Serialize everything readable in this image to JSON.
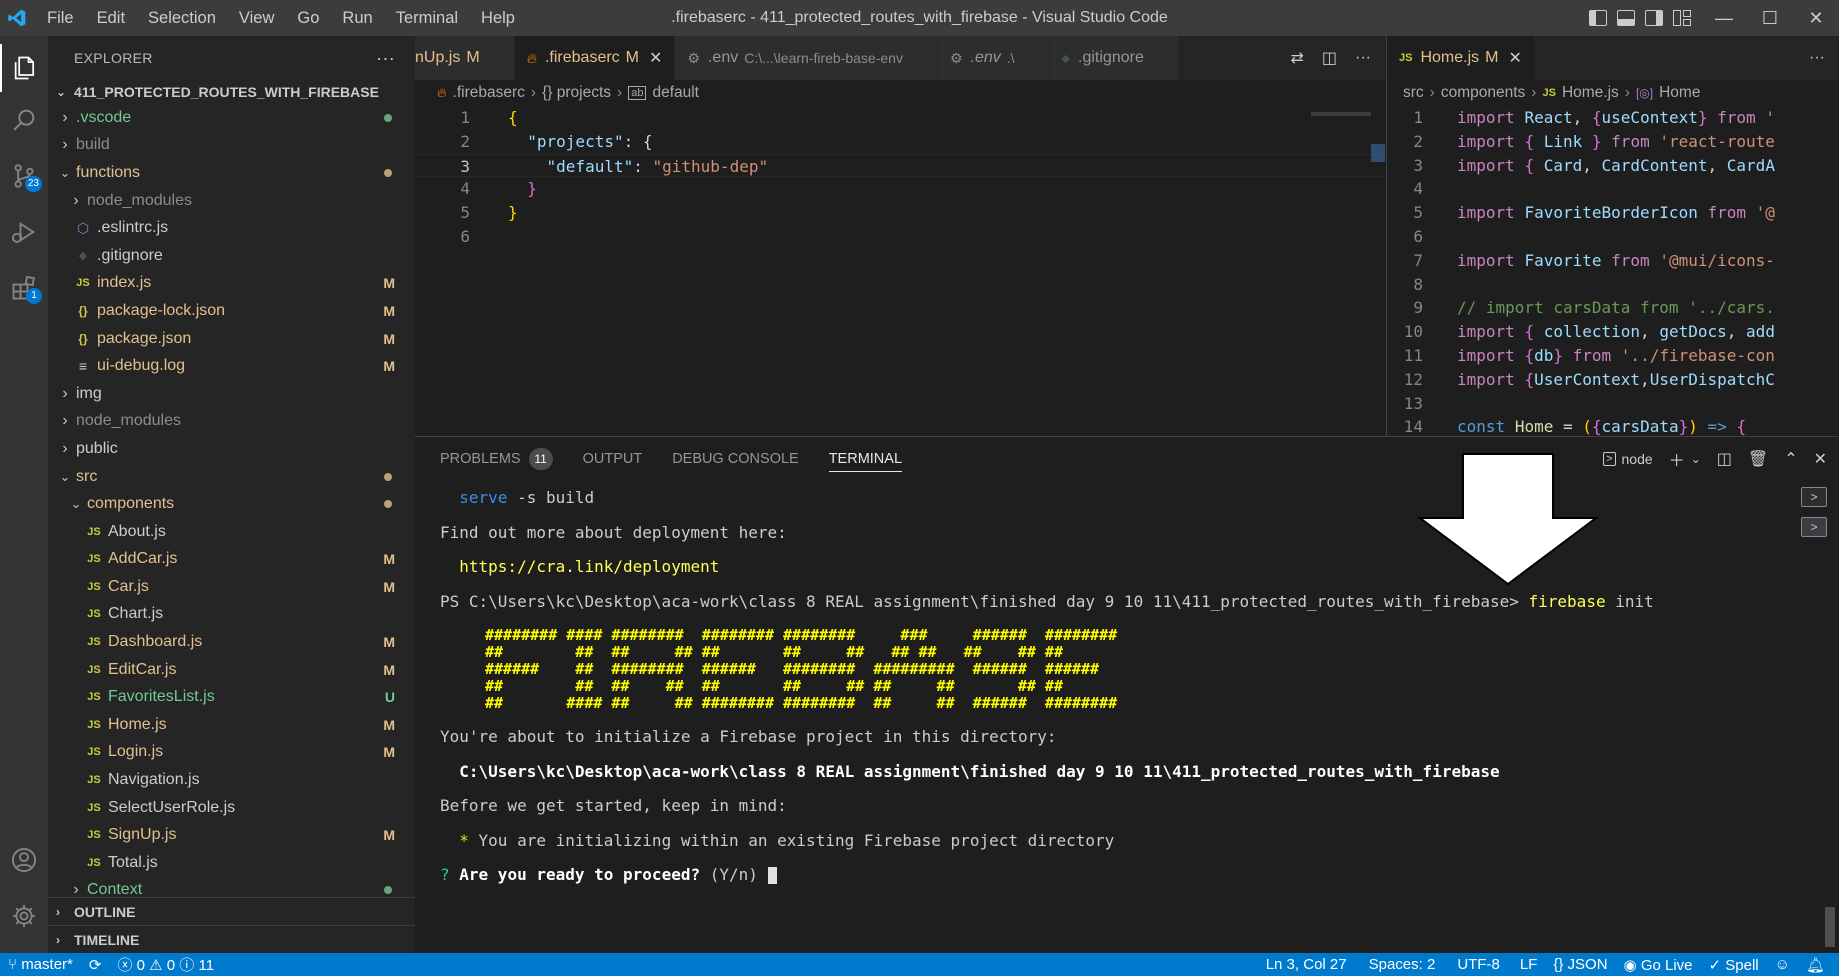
{
  "window": {
    "title": ".firebaserc - 411_protected_routes_with_firebase - Visual Studio Code",
    "menu": [
      "File",
      "Edit",
      "Selection",
      "View",
      "Go",
      "Run",
      "Terminal",
      "Help"
    ]
  },
  "activity": {
    "scm_badge": "23",
    "extensions_badge": "1"
  },
  "sidebar": {
    "header": "EXPLORER",
    "folder": "411_PROTECTED_ROUTES_WITH_FIREBASE",
    "tree": [
      {
        "label": ".vscode",
        "kind": "folder",
        "open": false,
        "depth": 1,
        "status": "",
        "dot": "#73c991",
        "color": "#73c991"
      },
      {
        "label": "build",
        "kind": "folder",
        "open": false,
        "depth": 1,
        "status": "",
        "dot": "",
        "color": "#8c8c8c"
      },
      {
        "label": "functions",
        "kind": "folder",
        "open": true,
        "depth": 1,
        "status": "",
        "dot": "#e2c08d",
        "color": "#e2c08d"
      },
      {
        "label": "node_modules",
        "kind": "folder",
        "open": false,
        "depth": 2,
        "status": "",
        "dot": "",
        "color": "#8c8c8c"
      },
      {
        "label": ".eslintrc.js",
        "kind": "eslint",
        "depth": 2,
        "status": "",
        "dot": "",
        "color": "#cccccc"
      },
      {
        "label": ".gitignore",
        "kind": "git",
        "depth": 2,
        "status": "",
        "dot": "",
        "color": "#cccccc"
      },
      {
        "label": "index.js",
        "kind": "js",
        "depth": 2,
        "status": "M",
        "dot": "",
        "color": "#e2c08d"
      },
      {
        "label": "package-lock.json",
        "kind": "json",
        "depth": 2,
        "status": "M",
        "dot": "",
        "color": "#e2c08d"
      },
      {
        "label": "package.json",
        "kind": "json",
        "depth": 2,
        "status": "M",
        "dot": "",
        "color": "#e2c08d"
      },
      {
        "label": "ui-debug.log",
        "kind": "log",
        "depth": 2,
        "status": "M",
        "dot": "",
        "color": "#e2c08d"
      },
      {
        "label": "img",
        "kind": "folder",
        "open": false,
        "depth": 1,
        "status": "",
        "dot": "",
        "color": "#cccccc"
      },
      {
        "label": "node_modules",
        "kind": "folder",
        "open": false,
        "depth": 1,
        "status": "",
        "dot": "",
        "color": "#8c8c8c"
      },
      {
        "label": "public",
        "kind": "folder",
        "open": false,
        "depth": 1,
        "status": "",
        "dot": "",
        "color": "#cccccc"
      },
      {
        "label": "src",
        "kind": "folder",
        "open": true,
        "depth": 1,
        "status": "",
        "dot": "#e2c08d",
        "color": "#e2c08d"
      },
      {
        "label": "components",
        "kind": "folder",
        "open": true,
        "depth": 2,
        "status": "",
        "dot": "#e2c08d",
        "color": "#e2c08d"
      },
      {
        "label": "About.js",
        "kind": "js",
        "depth": 3,
        "status": "",
        "dot": "",
        "color": "#cccccc"
      },
      {
        "label": "AddCar.js",
        "kind": "js",
        "depth": 3,
        "status": "M",
        "dot": "",
        "color": "#e2c08d"
      },
      {
        "label": "Car.js",
        "kind": "js",
        "depth": 3,
        "status": "M",
        "dot": "",
        "color": "#e2c08d"
      },
      {
        "label": "Chart.js",
        "kind": "js",
        "depth": 3,
        "status": "",
        "dot": "",
        "color": "#cccccc"
      },
      {
        "label": "Dashboard.js",
        "kind": "js",
        "depth": 3,
        "status": "M",
        "dot": "",
        "color": "#e2c08d"
      },
      {
        "label": "EditCar.js",
        "kind": "js",
        "depth": 3,
        "status": "M",
        "dot": "",
        "color": "#e2c08d"
      },
      {
        "label": "FavoritesList.js",
        "kind": "js",
        "depth": 3,
        "status": "U",
        "dot": "",
        "color": "#73c991"
      },
      {
        "label": "Home.js",
        "kind": "js",
        "depth": 3,
        "status": "M",
        "dot": "",
        "color": "#e2c08d"
      },
      {
        "label": "Login.js",
        "kind": "js",
        "depth": 3,
        "status": "M",
        "dot": "",
        "color": "#e2c08d"
      },
      {
        "label": "Navigation.js",
        "kind": "js",
        "depth": 3,
        "status": "",
        "dot": "",
        "color": "#cccccc"
      },
      {
        "label": "SelectUserRole.js",
        "kind": "js",
        "depth": 3,
        "status": "",
        "dot": "",
        "color": "#cccccc"
      },
      {
        "label": "SignUp.js",
        "kind": "js",
        "depth": 3,
        "status": "M",
        "dot": "",
        "color": "#e2c08d"
      },
      {
        "label": "Total.js",
        "kind": "js",
        "depth": 3,
        "status": "",
        "dot": "",
        "color": "#cccccc"
      },
      {
        "label": "Context",
        "kind": "folder",
        "open": false,
        "depth": 2,
        "status": "",
        "dot": "#73c991",
        "color": "#73c991"
      }
    ],
    "outline": "OUTLINE",
    "timeline": "TIMELINE"
  },
  "editor1": {
    "tabs": [
      {
        "label": "nUp.js",
        "icon": "",
        "mark": "M",
        "desc": "",
        "active": false
      },
      {
        "label": ".firebaserc",
        "icon": "firebase-icon",
        "mark": "M",
        "desc": "",
        "active": true
      },
      {
        "label": ".env",
        "icon": "gear-icon",
        "mark": "",
        "desc": "C:\\...\\learn-fireb-base-env",
        "active": false
      },
      {
        "label": ".env",
        "icon": "gear-icon",
        "mark": "",
        "desc": ".\\",
        "active": false
      },
      {
        "label": ".gitignore",
        "icon": "git-icon",
        "mark": "",
        "desc": "",
        "active": false
      }
    ],
    "breadcrumb": [
      ".firebaserc",
      "{} projects",
      "default"
    ],
    "lines": [
      "1",
      "2",
      "3",
      "4",
      "5",
      "6"
    ],
    "code": {
      "l1": "{",
      "l2_key": "\"projects\"",
      "l2_rest": ": {",
      "l3_key": "\"default\"",
      "l3_sep": ": ",
      "l3_val": "\"github-dep\"",
      "l4": "}",
      "l5": "}"
    }
  },
  "editor2": {
    "tab": "Home.js",
    "tab_mark": "M",
    "breadcrumb": [
      "src",
      "components",
      "Home.js",
      "Home"
    ],
    "lines": [
      "1",
      "2",
      "3",
      "4",
      "5",
      "6",
      "7",
      "8",
      "9",
      "10",
      "11",
      "12",
      "13",
      "14"
    ],
    "code": [
      [
        "import React, {useContext} from '"
      ],
      [
        "import { Link } from 'react-route"
      ],
      [
        "import { Card, CardContent, CardA"
      ],
      [
        ""
      ],
      [
        "import FavoriteBorderIcon from '@"
      ],
      [
        ""
      ],
      [
        "import Favorite from '@mui/icons-"
      ],
      [
        ""
      ],
      [
        "// import carsData from '../cars."
      ],
      [
        "import { collection, getDocs, add"
      ],
      [
        "import {db} from '../firebase-con"
      ],
      [
        "import {UserContext,UserDispatchC"
      ],
      [
        ""
      ],
      [
        "const Home = ({carsData}) => {"
      ]
    ]
  },
  "panel": {
    "tabs": [
      "PROBLEMS",
      "OUTPUT",
      "DEBUG CONSOLE",
      "TERMINAL"
    ],
    "problems_count": "11",
    "terminal_name": "node",
    "terminal": {
      "serve_cmd": "serve",
      "serve_args": " -s build",
      "findout": "Find out more about deployment here:",
      "link": "https://cra.link/deployment",
      "prompt": "PS C:\\Users\\kc\\Desktop\\aca-work\\class 8 REAL assignment\\finished day 9 10 11\\411_protected_routes_with_firebase> ",
      "cmd": "firebase",
      "cmd_args": " init",
      "ascii": [
        "######## #### ########  ######## ########     ###     ######  ########",
        "##        ##  ##     ## ##       ##     ##   ## ##   ##    ## ##",
        "######    ##  ########  ######   ########  #########  ######  ######",
        "##        ##  ##    ##  ##       ##     ## ##     ##       ## ##",
        "##       #### ##     ## ######## ########  ##     ##  ######  ########"
      ],
      "about": "You're about to initialize a Firebase project in this directory:",
      "dir": "C:\\Users\\kc\\Desktop\\aca-work\\class 8 REAL assignment\\finished day 9 10 11\\411_protected_routes_with_firebase",
      "before": "Before we get started, keep in mind:",
      "bullet": "*",
      "note": " You are initializing within an existing Firebase project directory",
      "q": "?",
      "question": " Are you ready to proceed?",
      "yn": " (Y/n) "
    }
  },
  "statusbar": {
    "branch": "master*",
    "errors": "0",
    "warnings": "0",
    "info": "11",
    "position": "Ln 3, Col 27",
    "spaces": "Spaces: 2",
    "encoding": "UTF-8",
    "eol": "LF",
    "language": "JSON",
    "golive": "Go Live",
    "spell": "Spell"
  }
}
